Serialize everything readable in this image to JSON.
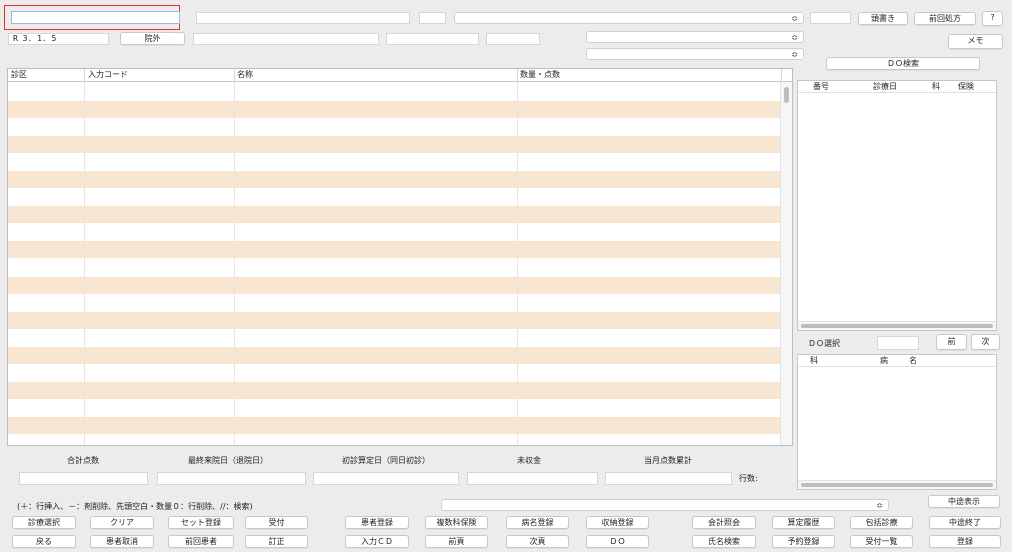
{
  "top": {
    "patient_id_value": "",
    "date_value": "R 3. 1. 5",
    "outpatient_label": "院外",
    "select_arrow": "⌃⌄",
    "header_notes_label": "頭書き",
    "prev_prescription_label": "前回処方",
    "help_label": "?",
    "memo_label": "メモ",
    "do_search_label": "ＤＯ検索"
  },
  "grid": {
    "headers": [
      "診区",
      "入力コード",
      "名称",
      "数量・点数"
    ],
    "row_count": 21
  },
  "history": {
    "headers": [
      "番号",
      "診療日",
      "科",
      "保険"
    ]
  },
  "do_select": {
    "label": "ＤＯ選択",
    "prev_label": "前",
    "next_label": "次"
  },
  "disease": {
    "headers": [
      "科",
      "病",
      "名"
    ]
  },
  "summary": {
    "total_points_label": "合計点数",
    "last_visit_label": "最終来院日（退院日）",
    "first_visit_label": "初診算定日（同日初診）",
    "unpaid_label": "未収金",
    "monthly_points_label": "当月点数累計",
    "row_count_label": "行数:"
  },
  "help_text": "(＋：行挿入、－：剤削除、先頭空白・数量０：行削除、//：検索)",
  "midway_display_label": "中途表示",
  "buttons_row1": [
    "診療選択",
    "クリア",
    "セット登録",
    "受付",
    "患者登録",
    "複数科保険",
    "病名登録",
    "収納登録",
    "会計照会",
    "算定履歴",
    "包括診療",
    "中途終了"
  ],
  "buttons_row2": [
    "戻る",
    "患者取消",
    "前回患者",
    "訂正",
    "入力ＣＤ",
    "前頁",
    "次頁",
    "ＤＯ",
    "氏名検索",
    "予約登録",
    "受付一覧",
    "登録"
  ],
  "colors": {
    "row_alt": "#f8e6d3",
    "focus_frame": "#d33333"
  }
}
